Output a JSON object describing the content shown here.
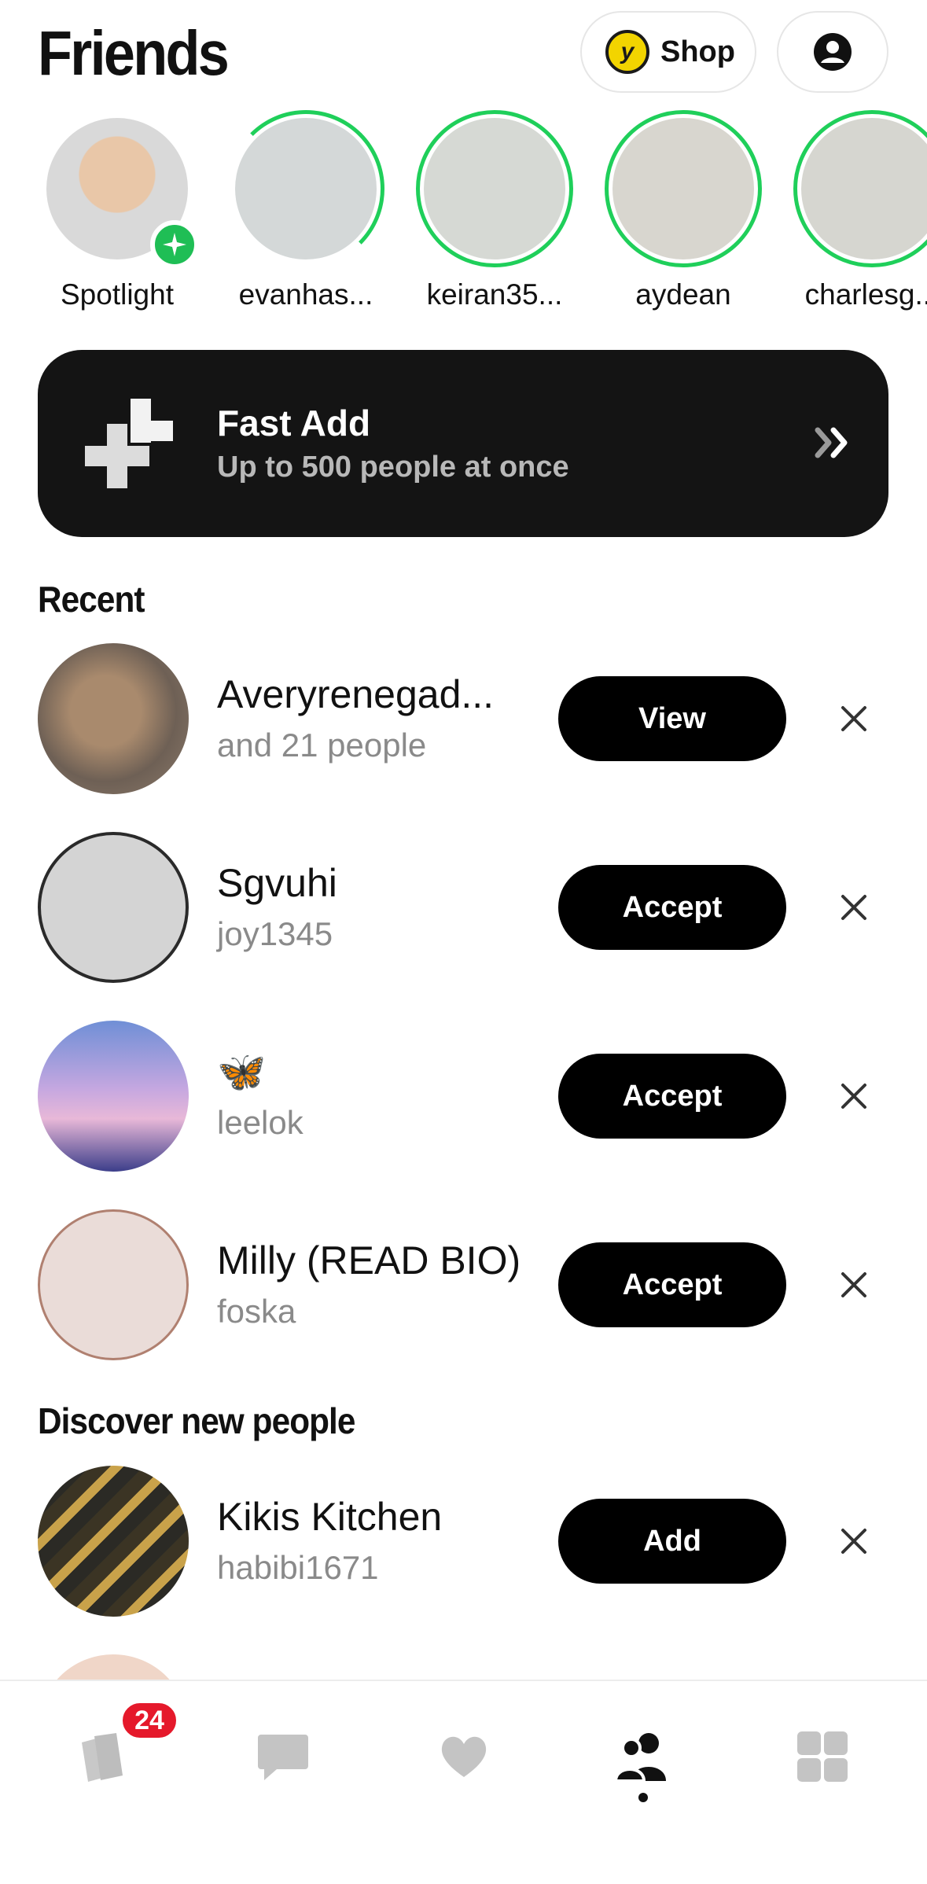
{
  "header": {
    "title": "Friends",
    "shop_label": "Shop",
    "shop_coin_letter": "y"
  },
  "stories": [
    {
      "name": "Spotlight",
      "ring": "none",
      "badge": "spotlight-plus"
    },
    {
      "name": "evanhas...",
      "ring": "green-partial"
    },
    {
      "name": "keiran35...",
      "ring": "green"
    },
    {
      "name": "aydean",
      "ring": "green"
    },
    {
      "name": "charlesg...",
      "ring": "green"
    }
  ],
  "fast_add": {
    "title": "Fast Add",
    "subtitle": "Up to 500 people at once"
  },
  "recent": {
    "title": "Recent",
    "rows": [
      {
        "name": "Averyrenegad...",
        "sub": "and 21 people",
        "button": "View"
      },
      {
        "name": "Sgvuhi",
        "sub": "joy1345",
        "button": "Accept"
      },
      {
        "name": "🦋",
        "sub": "leelok",
        "button": "Accept"
      },
      {
        "name": "Milly (READ BIO)",
        "sub": "foska",
        "button": "Accept"
      }
    ]
  },
  "discover": {
    "title": "Discover new people",
    "rows": [
      {
        "name": "Kikis Kitchen",
        "sub": "habibi1671",
        "button": "Add"
      }
    ]
  },
  "tabbar": {
    "badge_count": "24",
    "tabs": [
      "cards-icon",
      "chat-icon",
      "heart-icon",
      "friends-icon",
      "grid-icon"
    ],
    "active": "friends-icon"
  },
  "colors": {
    "accent_green": "#1fcf5a",
    "badge_red": "#e5192b",
    "fast_add_bg": "#141414"
  }
}
